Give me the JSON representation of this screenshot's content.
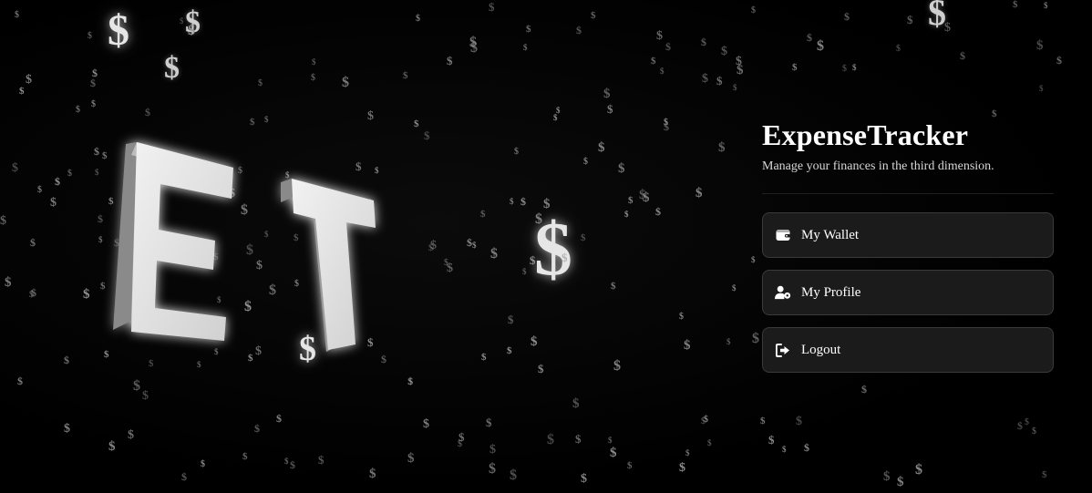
{
  "app": {
    "title": "ExpenseTracker",
    "subtitle": "Manage your finances in the third dimension."
  },
  "hero": {
    "logo_text": "ET",
    "symbol": "$"
  },
  "menu": [
    {
      "label": "My Wallet",
      "icon": "wallet-icon"
    },
    {
      "label": "My Profile",
      "icon": "user-gear-icon"
    },
    {
      "label": "Logout",
      "icon": "logout-icon"
    }
  ],
  "colors": {
    "background": "#000000",
    "button_bg": "#1b1b1b",
    "button_border": "#3a3a3a",
    "text": "#ffffff"
  }
}
